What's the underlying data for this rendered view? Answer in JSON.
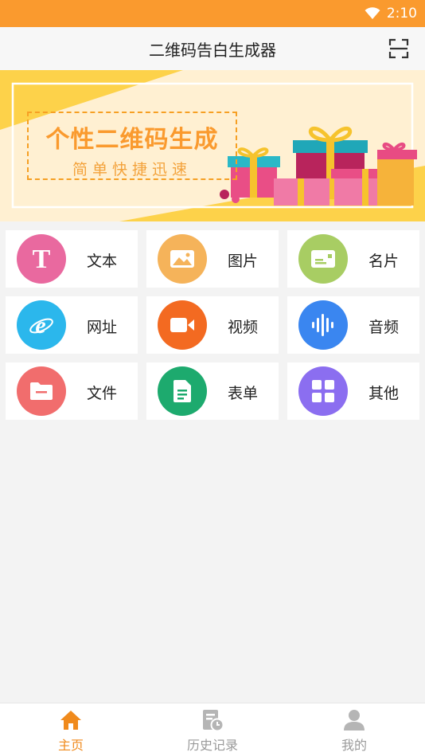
{
  "status_bar": {
    "time": "2:10",
    "color": "#fa9a2e"
  },
  "header": {
    "title": "二维码告白生成器",
    "scan_icon": "scan-icon"
  },
  "banner": {
    "title": "个性二维码生成",
    "subtitle": "简单快捷迅速"
  },
  "grid": {
    "items": [
      {
        "label": "文本",
        "icon": "text-icon",
        "color": "#e9699f"
      },
      {
        "label": "图片",
        "icon": "image-icon",
        "color": "#f5b35a"
      },
      {
        "label": "名片",
        "icon": "card-icon",
        "color": "#a8cd63"
      },
      {
        "label": "网址",
        "icon": "browser-icon",
        "color": "#2bb7ec"
      },
      {
        "label": "视频",
        "icon": "video-icon",
        "color": "#f36a21"
      },
      {
        "label": "音频",
        "icon": "audio-icon",
        "color": "#3a86f0"
      },
      {
        "label": "文件",
        "icon": "folder-icon",
        "color": "#f16d6d"
      },
      {
        "label": "表单",
        "icon": "form-icon",
        "color": "#1daa6e"
      },
      {
        "label": "其他",
        "icon": "grid-icon",
        "color": "#8b6ef0"
      }
    ]
  },
  "bottom_nav": {
    "items": [
      {
        "label": "主页",
        "icon": "home-icon",
        "active": true
      },
      {
        "label": "历史记录",
        "icon": "history-icon",
        "active": false
      },
      {
        "label": "我的",
        "icon": "user-icon",
        "active": false
      }
    ],
    "active_color": "#f08a1c"
  }
}
